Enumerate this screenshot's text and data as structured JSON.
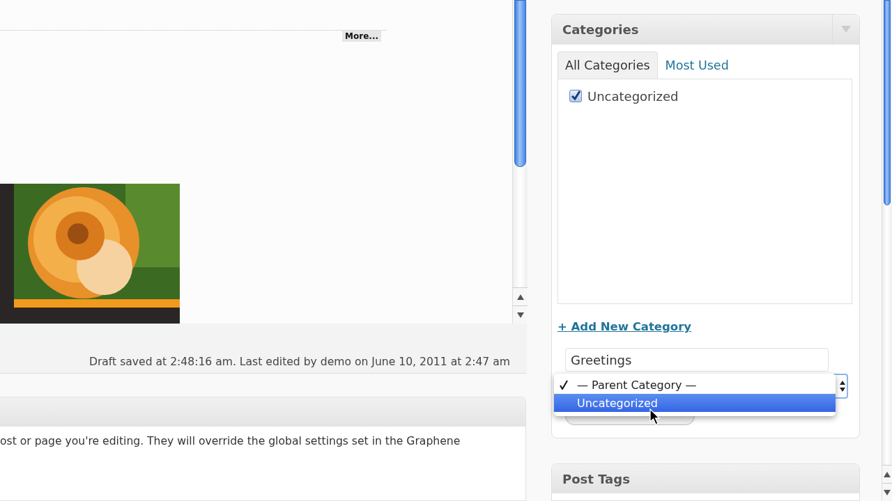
{
  "editor": {
    "more_tag": "More..."
  },
  "status_bar": {
    "text": "Draft saved at 2:48:16 am. Last edited by demo on June 10, 2011 at 2:47 am"
  },
  "options_panel": {
    "text": "ost or page you're editing. They will override the global settings set in the Graphene"
  },
  "categories_panel": {
    "title": "Categories",
    "tabs": [
      {
        "label": "All Categories",
        "selected": true
      },
      {
        "label": "Most Used",
        "selected": false
      }
    ],
    "items": [
      {
        "label": "Uncategorized",
        "checked": true
      }
    ],
    "add_link": "+ Add New Category",
    "new_category_field": {
      "value": "Greetings"
    },
    "parent_menu": [
      {
        "label": "— Parent Category —",
        "checked": true,
        "selected": false
      },
      {
        "label": "Uncategorized",
        "checked": false,
        "selected": true
      }
    ]
  },
  "tags_panel": {
    "title": "Post Tags"
  }
}
